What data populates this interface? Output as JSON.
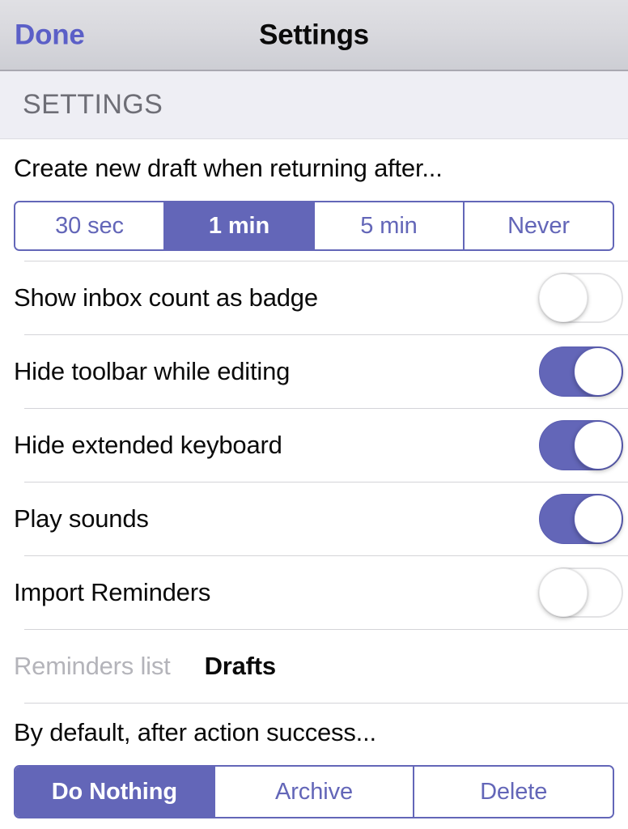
{
  "navbar": {
    "done_label": "Done",
    "title": "Settings"
  },
  "section": {
    "header": "SETTINGS"
  },
  "draft_timeout": {
    "prompt": "Create new draft when returning after...",
    "options": [
      {
        "label": "30 sec",
        "selected": false
      },
      {
        "label": "1 min",
        "selected": true
      },
      {
        "label": "5 min",
        "selected": false
      },
      {
        "label": "Never",
        "selected": false
      }
    ]
  },
  "toggles": [
    {
      "label": "Show inbox count as badge",
      "state": "off"
    },
    {
      "label": "Hide toolbar while editing",
      "state": "on"
    },
    {
      "label": "Hide extended keyboard",
      "state": "on"
    },
    {
      "label": "Play sounds",
      "state": "on"
    },
    {
      "label": "Import Reminders",
      "state": "off"
    }
  ],
  "reminders_list": {
    "label": "Reminders list",
    "value": "Drafts",
    "disabled": true
  },
  "action_success": {
    "prompt": "By default, after action success...",
    "options": [
      {
        "label": "Do Nothing",
        "selected": true
      },
      {
        "label": "Archive",
        "selected": false
      },
      {
        "label": "Delete",
        "selected": false
      }
    ]
  },
  "colors": {
    "accent": "#6366b8",
    "done_text": "#5b5fc7",
    "section_header_text": "#6e6e76",
    "section_band_bg": "#eeeef4",
    "navbar_top": "#e0e0e4",
    "navbar_bottom": "#cdced4",
    "separator": "#d4d4d8",
    "disabled_text": "#b4b4ba"
  }
}
